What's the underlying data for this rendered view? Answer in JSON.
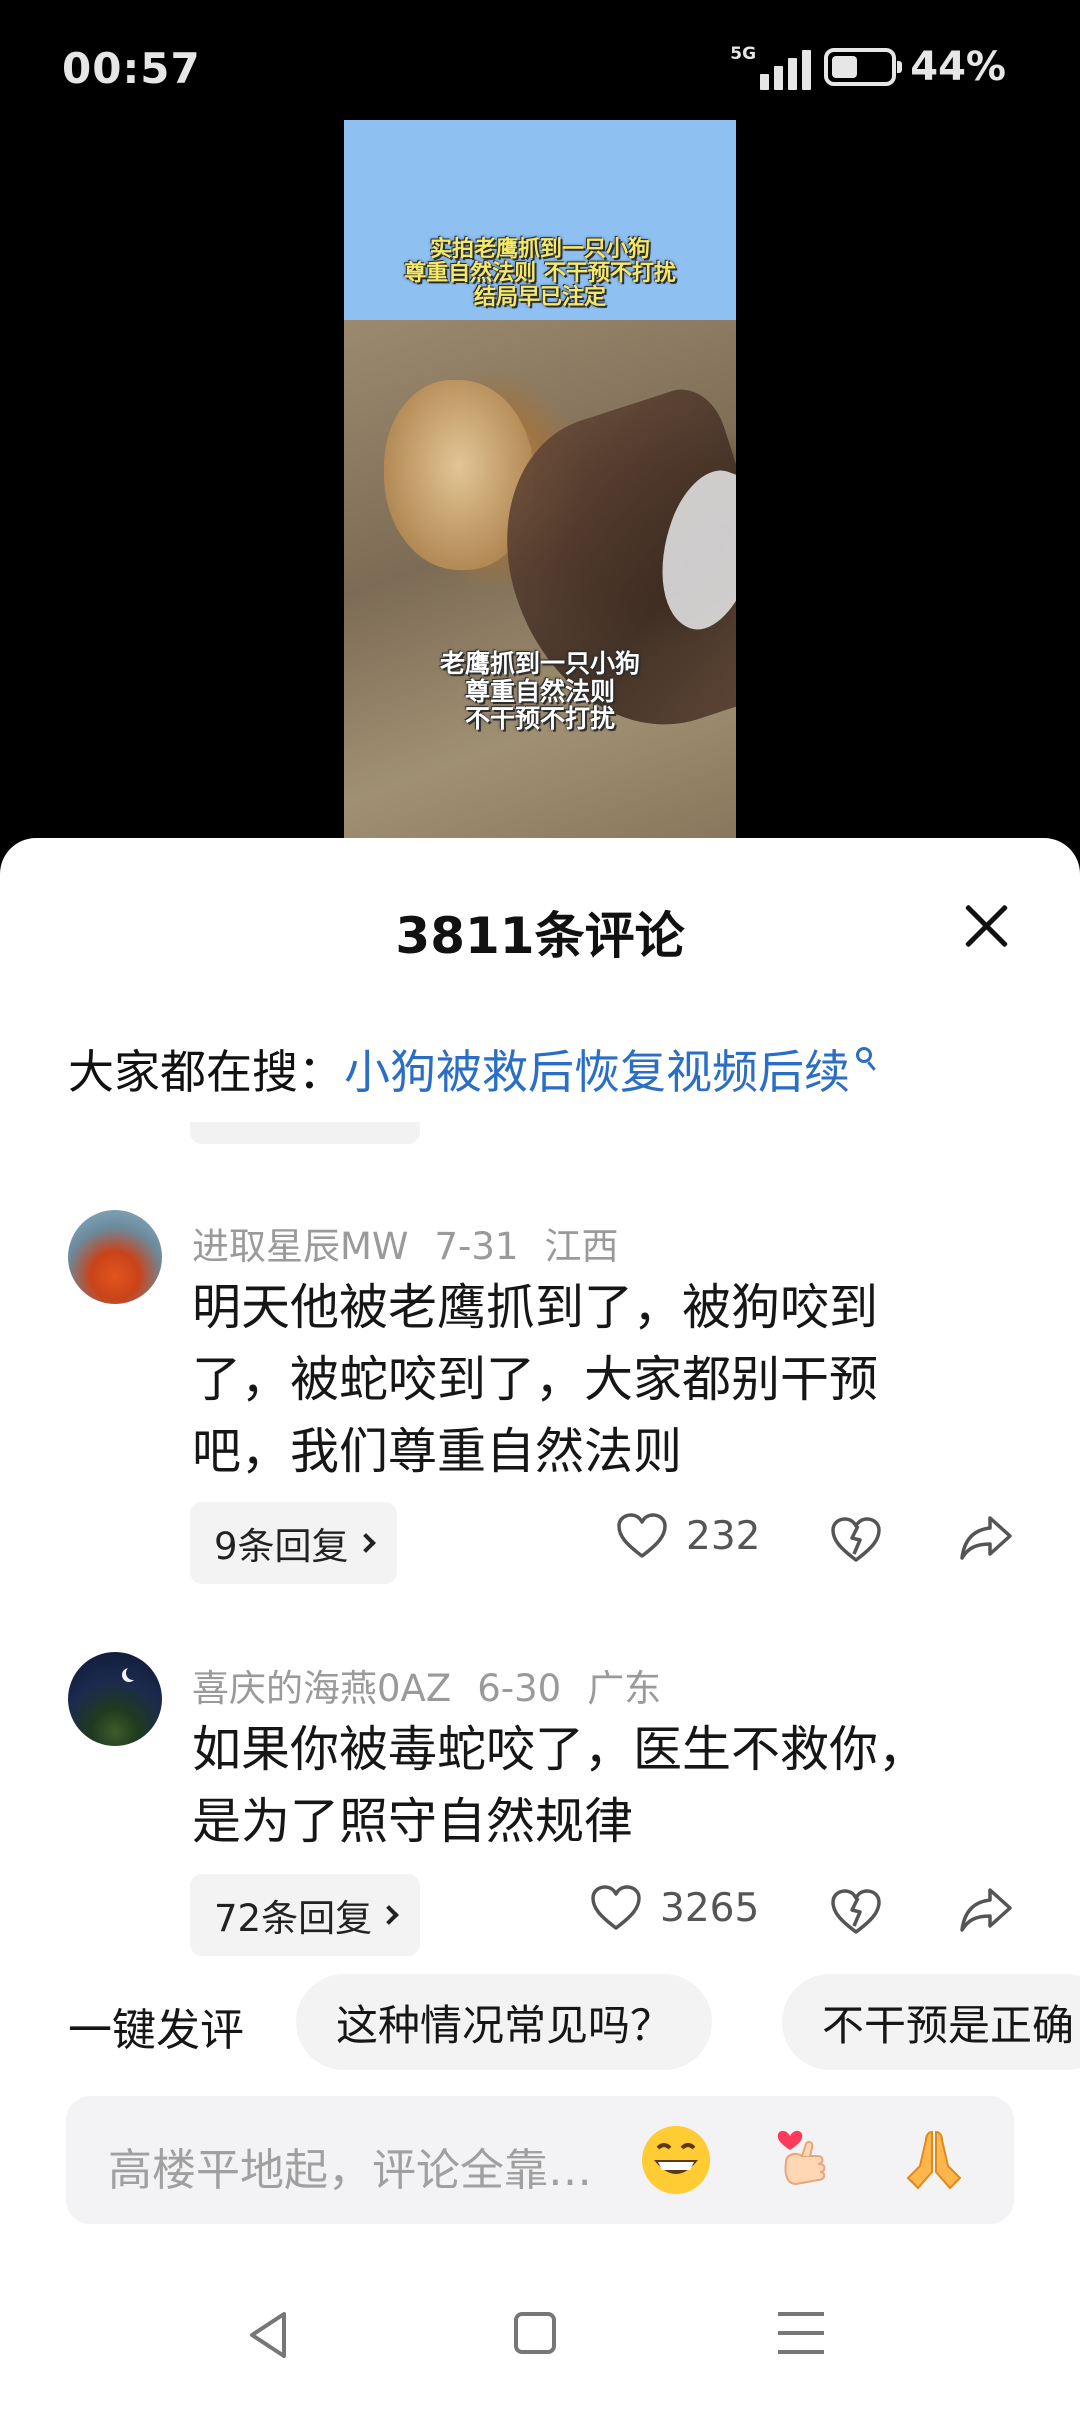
{
  "status_bar": {
    "time": "00:57",
    "network": "5G",
    "battery_text": "44%",
    "battery_level": 0.44
  },
  "video": {
    "caption_top": [
      "实拍老鹰抓到一只小狗",
      "尊重自然法则 不干预不打扰",
      "结局早已注定"
    ],
    "caption_bottom": [
      "老鹰抓到一只小狗",
      "尊重自然法则",
      "不干预不打扰"
    ]
  },
  "sheet": {
    "title": "3811条评论",
    "search_label": "大家都在搜：",
    "search_query": "小狗被救后恢复视频后续"
  },
  "comments": [
    {
      "user": "进取星辰MW",
      "date": "7-31",
      "location": "江西",
      "lines": [
        "明天他被老鹰抓到了，被狗咬到",
        "了，被蛇咬到了，大家都别干预",
        "吧，我们尊重自然法则"
      ],
      "replies": "9条回复",
      "likes": "232"
    },
    {
      "user": "喜庆的海燕0AZ",
      "date": "6-30",
      "location": "广东",
      "lines": [
        "如果你被毒蛇咬了，医生不救你，",
        "是为了照守自然规律"
      ],
      "replies": "72条回复",
      "likes": "3265"
    }
  ],
  "quick_comment": {
    "label": "一键发评",
    "chips": [
      "这种情况常见吗？",
      "不干预是正确"
    ]
  },
  "input": {
    "placeholder": "高楼平地起，评论全靠…",
    "emojis": [
      "grinning-face-emoji",
      "finger-heart-emoji",
      "folded-hands-emoji"
    ]
  },
  "colors": {
    "link": "#2a6ec5",
    "video_bg": "#8ec0f2",
    "caption": "#f4e86a"
  }
}
